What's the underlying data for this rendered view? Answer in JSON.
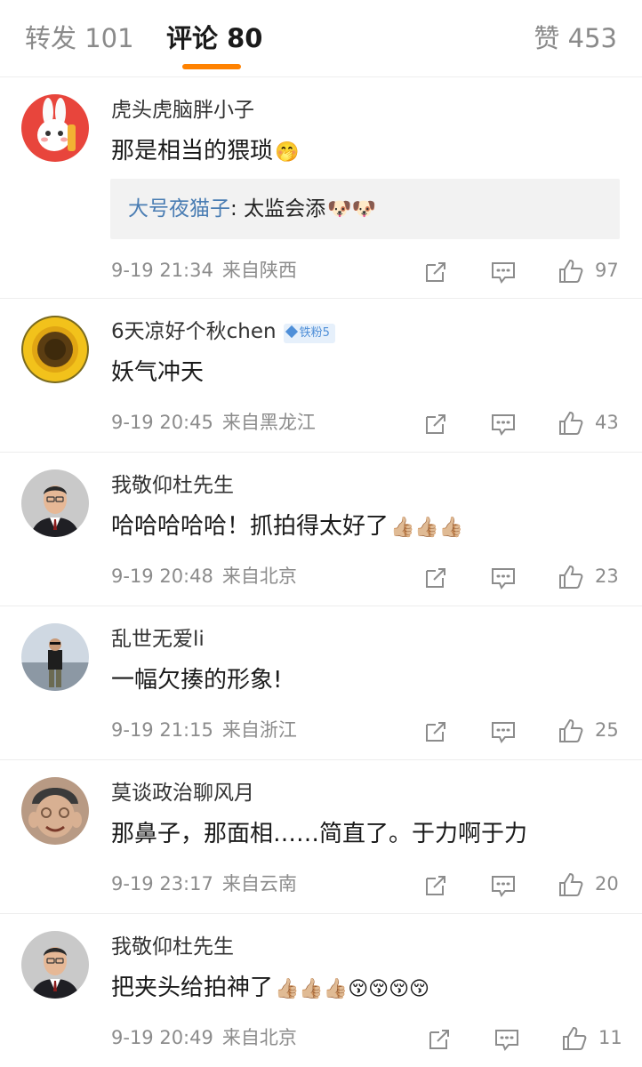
{
  "tabs": [
    {
      "label": "转发 101",
      "active": false
    },
    {
      "label": "评论 80",
      "active": true
    },
    {
      "label": "赞 453",
      "active": false
    }
  ],
  "accent_color": "#ff8200",
  "link_color": "#4a7db3",
  "comments": [
    {
      "username": "虎头虎脑胖小子",
      "text": "那是相当的猥琐",
      "emoji": "🤭",
      "avatar_icon": "rabbit-avatar",
      "reply": {
        "user": "大号夜猫子",
        "sep": ": ",
        "text": "太监会添",
        "emoji": "🐶🐶"
      },
      "time": "9-19 21:34",
      "location": "来自陕西",
      "likes": "97"
    },
    {
      "username": "6天凉好个秋chen",
      "badge": "铁粉5",
      "text": "妖气冲天",
      "avatar_icon": "sunflower-avatar",
      "time": "9-19 20:45",
      "location": "来自黑龙江",
      "likes": "43"
    },
    {
      "username": "我敬仰杜先生",
      "text": "哈哈哈哈哈！抓拍得太好了",
      "emoji": "👍🏼👍🏼👍🏼",
      "avatar_icon": "man-suit-avatar",
      "time": "9-19 20:48",
      "location": "来自北京",
      "likes": "23"
    },
    {
      "username": "乱世无爱li",
      "text": "一幅欠揍的形象!",
      "avatar_icon": "man-outdoor-avatar",
      "time": "9-19 21:15",
      "location": "来自浙江",
      "likes": "25"
    },
    {
      "username": "莫谈政治聊风月",
      "text": "那鼻子，那面相……简直了。于力啊于力",
      "avatar_icon": "funny-face-avatar",
      "time": "9-19 23:17",
      "location": "来自云南",
      "likes": "20"
    },
    {
      "username": "我敬仰杜先生",
      "text": "把夹头给拍神了",
      "emoji": "👍🏼👍🏼👍🏼😚😚😚😚",
      "avatar_icon": "man-suit-avatar",
      "time": "9-19 20:49",
      "location": "来自北京",
      "likes": "11"
    }
  ]
}
